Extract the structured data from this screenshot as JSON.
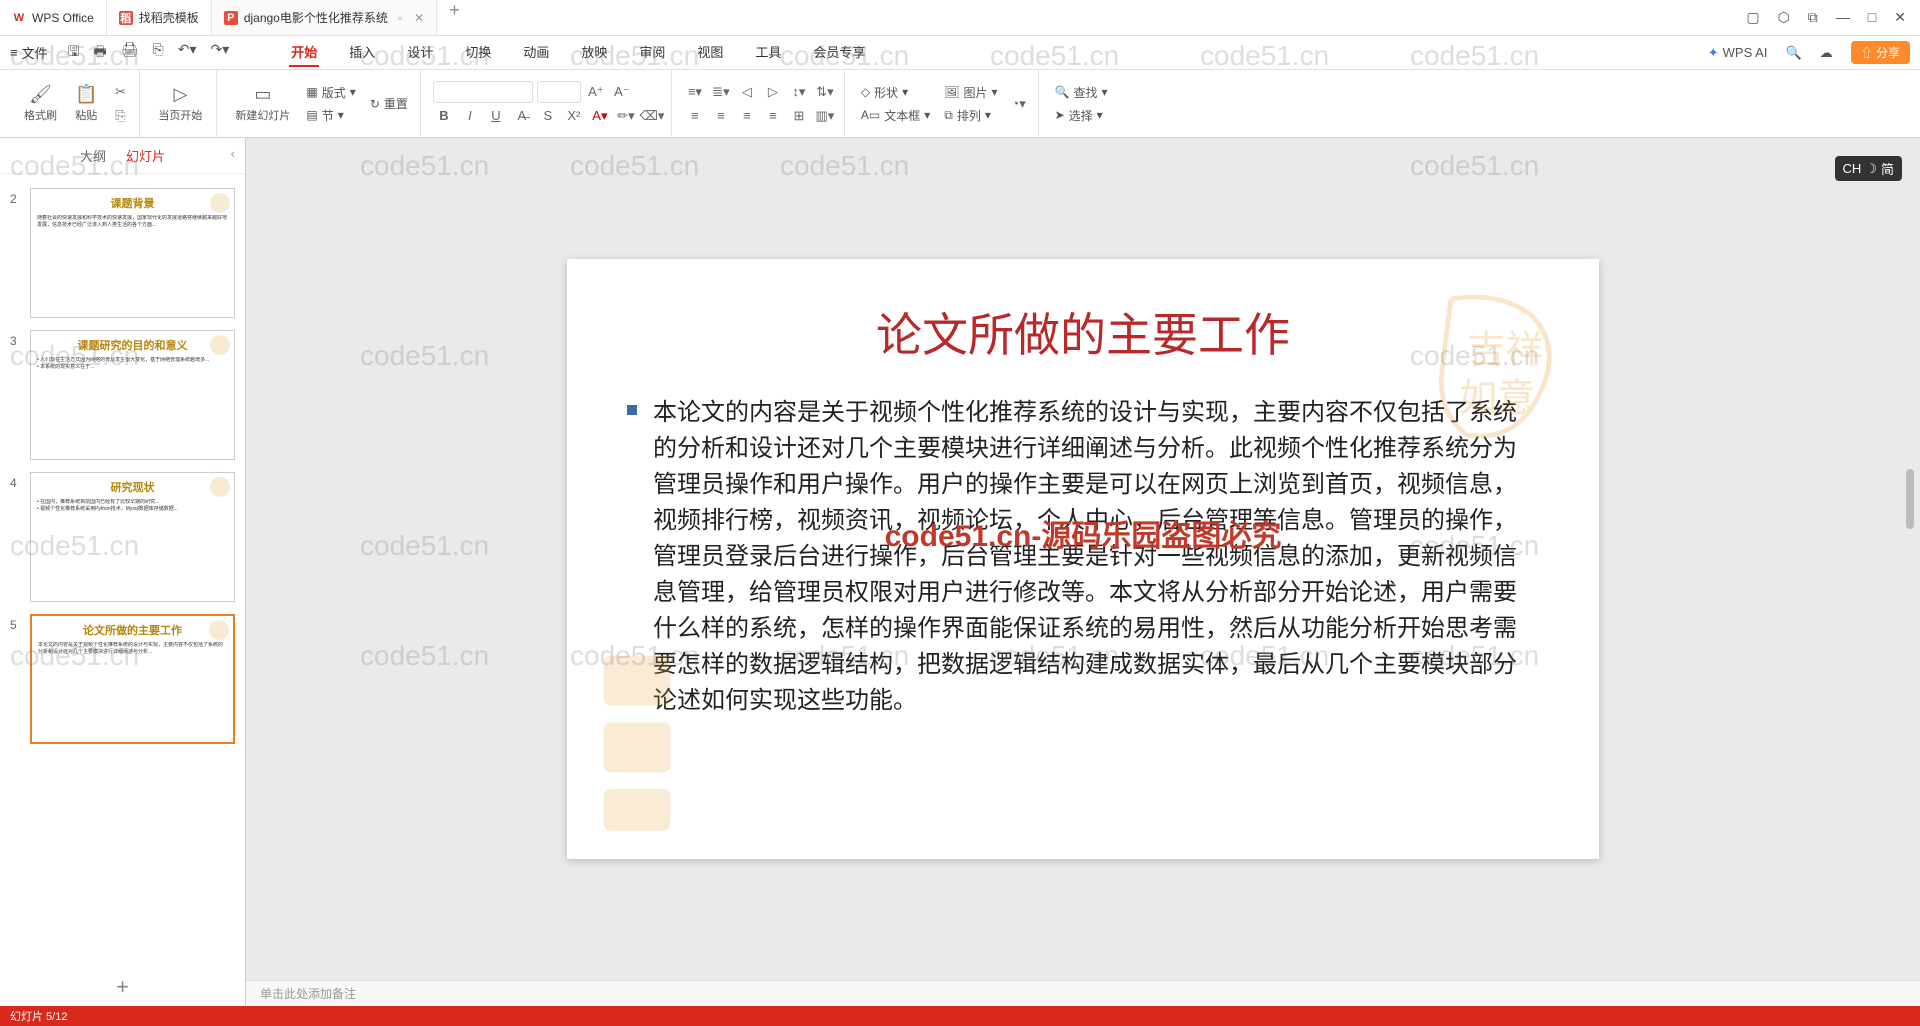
{
  "titlebar": {
    "tabs": [
      {
        "icon": "W",
        "label": "WPS Office"
      },
      {
        "icon": "稻",
        "label": "找稻壳模板"
      },
      {
        "icon": "P",
        "label": "django电影个性化推荐系统"
      }
    ],
    "controls": {
      "min": "—",
      "max": "□",
      "close": "✕"
    }
  },
  "menubar": {
    "file": "文件",
    "tabs": [
      "开始",
      "插入",
      "设计",
      "切换",
      "动画",
      "放映",
      "审阅",
      "视图",
      "工具",
      "会员专享"
    ],
    "active": 0,
    "ai": "WPS AI",
    "share": "分享"
  },
  "ribbon": {
    "format_painter": "格式刷",
    "paste": "粘贴",
    "start_from": "当页开始",
    "new_slide": "新建幻灯片",
    "layout": "版式",
    "section": "节",
    "reset": "重置",
    "shape": "形状",
    "picture": "图片",
    "textbox": "文本框",
    "arrange": "排列",
    "find": "查找",
    "select": "选择"
  },
  "thumbs": {
    "outline": "大纲",
    "slides": "幻灯片",
    "items": [
      {
        "num": "2",
        "title": "课题背景"
      },
      {
        "num": "3",
        "title": "课题研究的目的和意义"
      },
      {
        "num": "4",
        "title": "研究现状"
      },
      {
        "num": "5",
        "title": "论文所做的主要工作"
      }
    ],
    "selected": 3
  },
  "slide": {
    "title": "论文所做的主要工作",
    "body": "本论文的内容是关于视频个性化推荐系统的设计与实现，主要内容不仅包括了系统的分析和设计还对几个主要模块进行详细阐述与分析。此视频个性化推荐系统分为管理员操作和用户操作。用户的操作主要是可以在网页上浏览到首页，视频信息，视频排行榜，视频资讯，视频论坛，个人中心，后台管理等信息。管理员的操作，管理员登录后台进行操作，后台管理主要是针对一些视频信息的添加，更新视频信息管理，给管理员权限对用户进行修改等。本文将从分析部分开始论述，用户需要什么样的系统，怎样的操作界面能保证系统的易用性，然后从功能分析开始思考需要怎样的数据逻辑结构，把数据逻辑结构建成数据实体，最后从几个主要模块部分论述如何实现这些功能。",
    "watermark_center": "code51.cn-源码乐园盗图必究"
  },
  "notes": "单击此处添加备注",
  "ime": {
    "lang": "CH",
    "mode": "简"
  },
  "watermark": "code51.cn",
  "status": {
    "slide_info": "幻灯片 5/12"
  }
}
